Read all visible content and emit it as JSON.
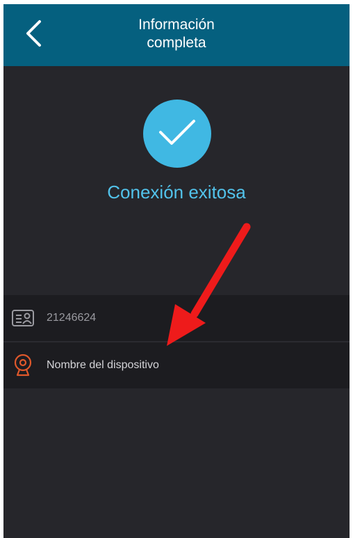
{
  "header": {
    "title": "Información\ncompleta",
    "back_icon": "chevron-left-icon",
    "background": "#05607f"
  },
  "status": {
    "icon": "checkmark-icon",
    "text": "Conexión exitosa",
    "accent": "#40b8e3"
  },
  "device_info": {
    "id": {
      "icon": "id-card-icon",
      "value": "21246624"
    },
    "name": {
      "icon": "camera-icon",
      "placeholder": "Nombre del dispositivo",
      "icon_color": "#e0582b"
    }
  },
  "annotation": {
    "icon": "red-arrow-annotation",
    "color": "#ee1b1b"
  }
}
